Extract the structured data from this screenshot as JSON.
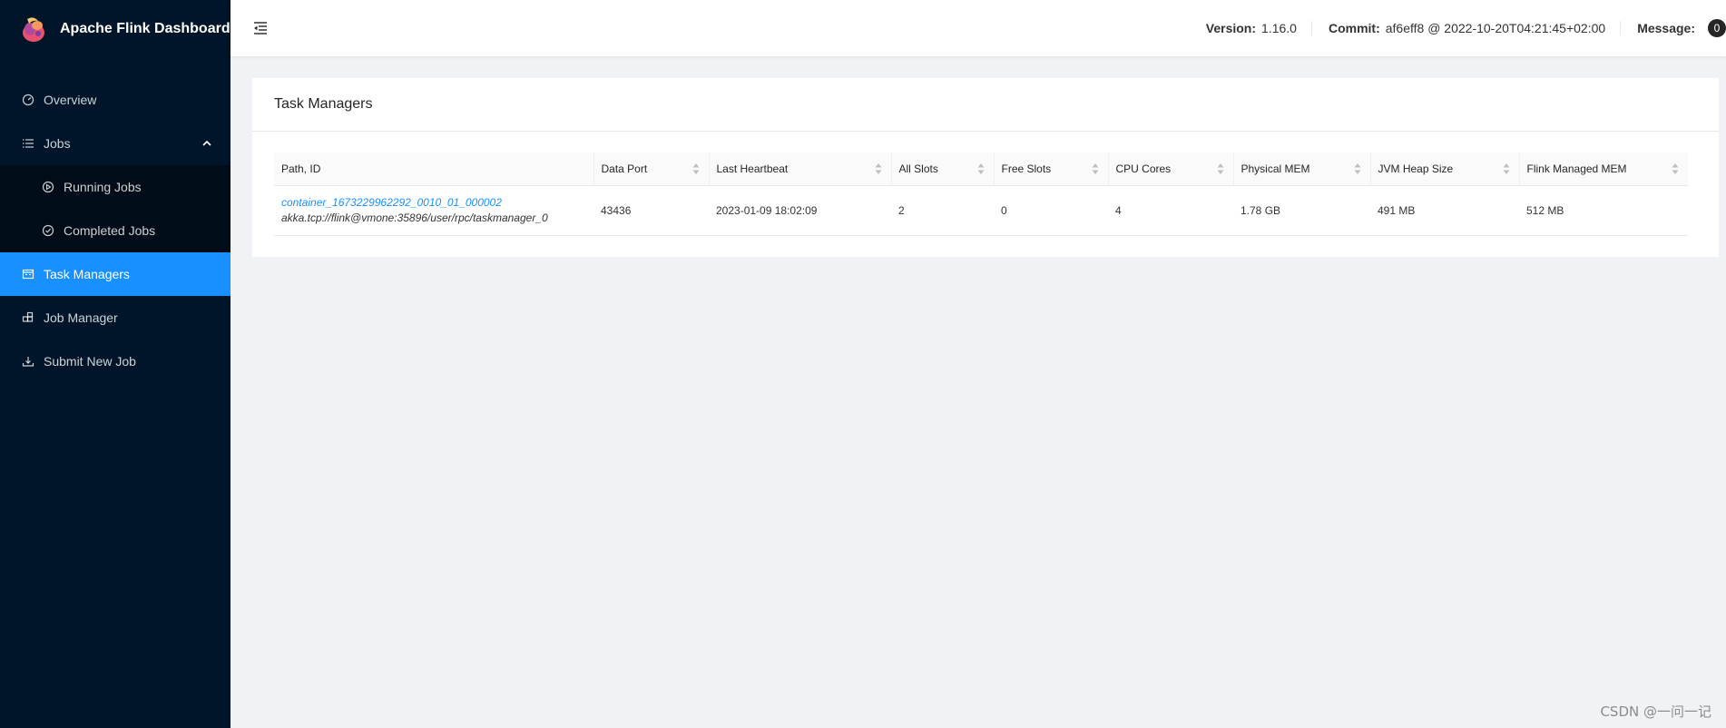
{
  "app": {
    "title": "Apache Flink Dashboard"
  },
  "sidebar": {
    "items": [
      {
        "label": "Overview",
        "icon": "dashboard-icon"
      },
      {
        "label": "Jobs",
        "icon": "list-icon",
        "expanded": true
      },
      {
        "label": "Running Jobs",
        "icon": "play-circle-icon"
      },
      {
        "label": "Completed Jobs",
        "icon": "check-circle-icon"
      },
      {
        "label": "Task Managers",
        "icon": "schedule-icon",
        "active": true
      },
      {
        "label": "Job Manager",
        "icon": "build-icon"
      },
      {
        "label": "Submit New Job",
        "icon": "upload-icon"
      }
    ]
  },
  "header": {
    "version_label": "Version:",
    "version_value": "1.16.0",
    "commit_label": "Commit:",
    "commit_value": "af6eff8 @ 2022-10-20T04:21:45+02:00",
    "message_label": "Message:",
    "message_count": "0"
  },
  "card": {
    "title": "Task Managers",
    "columns": [
      "Path, ID",
      "Data Port",
      "Last Heartbeat",
      "All Slots",
      "Free Slots",
      "CPU Cores",
      "Physical MEM",
      "JVM Heap Size",
      "Flink Managed MEM"
    ],
    "rows": [
      {
        "path": "container_1673229962292_0010_01_000002",
        "id": "akka.tcp://flink@vmone:35896/user/rpc/taskmanager_0",
        "data_port": "43436",
        "last_heartbeat": "2023-01-09 18:02:09",
        "all_slots": "2",
        "free_slots": "0",
        "cpu_cores": "4",
        "physical_mem": "1.78 GB",
        "jvm_heap": "491 MB",
        "flink_managed_mem": "512 MB"
      }
    ]
  },
  "watermark": "CSDN @一问一记",
  "colors": {
    "sidebar_bg": "#001529",
    "active": "#1890ff",
    "link": "#1890ff"
  }
}
